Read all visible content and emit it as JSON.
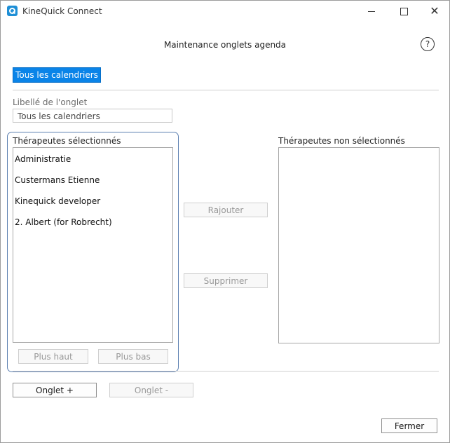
{
  "window": {
    "app_title": "KineQuick Connect",
    "controls": {
      "minimize": "minimize",
      "maximize": "maximize",
      "close": "✕"
    }
  },
  "header": {
    "title": "Maintenance onglets agenda",
    "help": "?"
  },
  "tab": {
    "active_label": "Tous les calendriers"
  },
  "form": {
    "name_label": "Libellé de l'onglet",
    "name_value": "Tous les calendriers"
  },
  "selected": {
    "label": "Thérapeutes sélectionnés",
    "items": [
      "Administratie",
      "Custermans Etienne",
      "Kinequick developer",
      "2. Albert (for Robrecht)"
    ]
  },
  "unselected": {
    "label": "Thérapeutes non sélectionnés",
    "items": []
  },
  "buttons": {
    "add": "Rajouter",
    "remove": "Supprimer",
    "up": "Plus haut",
    "down": "Plus bas",
    "tab_add": "Onglet +",
    "tab_remove": "Onglet -",
    "close": "Fermer"
  },
  "colors": {
    "accent": "#0a84e8",
    "frame": "#5b7fb0"
  }
}
